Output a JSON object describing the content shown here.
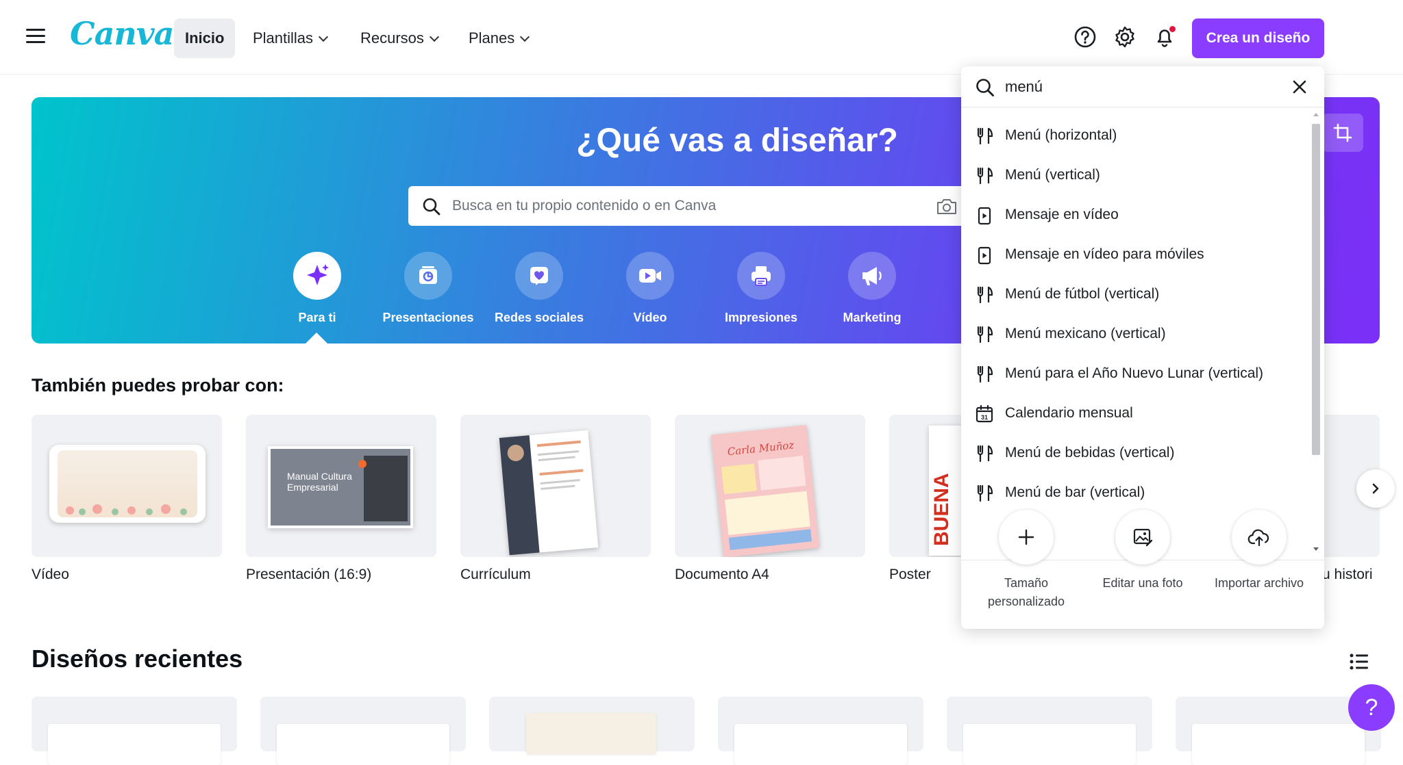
{
  "brand": {
    "logo_text": "Canva",
    "accent": "#8b3dff"
  },
  "nav": {
    "items": [
      {
        "label": "Inicio",
        "active": true
      },
      {
        "label": "Plantillas",
        "has_chevron": true
      },
      {
        "label": "Recursos",
        "has_chevron": true
      },
      {
        "label": "Planes",
        "has_chevron": true
      }
    ],
    "create_label": "Crea un diseño",
    "icons": [
      "help-icon",
      "settings-icon",
      "bell-icon"
    ]
  },
  "hero": {
    "title": "¿Qué vas a diseñar?",
    "search_placeholder": "Busca en tu propio contenido o en Canva",
    "categories": [
      {
        "label": "Para ti",
        "icon": "sparkle-icon",
        "active": true
      },
      {
        "label": "Presentaciones",
        "icon": "presentation-icon"
      },
      {
        "label": "Redes sociales",
        "icon": "heart-icon"
      },
      {
        "label": "Vídeo",
        "icon": "video-icon"
      },
      {
        "label": "Impresiones",
        "icon": "printer-icon"
      },
      {
        "label": "Marketing",
        "icon": "megaphone-icon"
      }
    ]
  },
  "try_section": {
    "title": "También puedes probar con:",
    "cards": [
      {
        "label": "Vídeo"
      },
      {
        "label": "Presentación (16:9)"
      },
      {
        "label": "Currículum"
      },
      {
        "label": "Documento A4"
      },
      {
        "label": "Poster"
      },
      {
        "label": "Tu histori"
      }
    ],
    "thumb_texts": {
      "presentation": "Manual Cultura Empresarial",
      "document_name": "Carla Muñoz",
      "poster_word": "BUENA"
    }
  },
  "recent": {
    "title": "Diseños recientes"
  },
  "help_fab": "?",
  "dropdown": {
    "search_value": "menú",
    "items": [
      {
        "label": "Menú (horizontal)",
        "icon": "utensils-icon"
      },
      {
        "label": "Menú (vertical)",
        "icon": "utensils-icon"
      },
      {
        "label": "Mensaje en vídeo",
        "icon": "video-phone-icon"
      },
      {
        "label": "Mensaje en vídeo para móviles",
        "icon": "video-phone-icon"
      },
      {
        "label": "Menú de fútbol (vertical)",
        "icon": "utensils-icon"
      },
      {
        "label": "Menú mexicano (vertical)",
        "icon": "utensils-icon"
      },
      {
        "label": "Menú para el Año Nuevo Lunar (vertical)",
        "icon": "utensils-icon"
      },
      {
        "label": "Calendario mensual",
        "icon": "calendar-icon"
      },
      {
        "label": "Menú de bebidas (vertical)",
        "icon": "utensils-icon"
      },
      {
        "label": "Menú de bar (vertical)",
        "icon": "utensils-icon"
      }
    ],
    "actions": [
      {
        "label": "Tamaño personalizado",
        "icon": "plus-icon"
      },
      {
        "label": "Editar una foto",
        "icon": "image-edit-icon"
      },
      {
        "label": "Importar archivo",
        "icon": "cloud-upload-icon"
      }
    ]
  }
}
